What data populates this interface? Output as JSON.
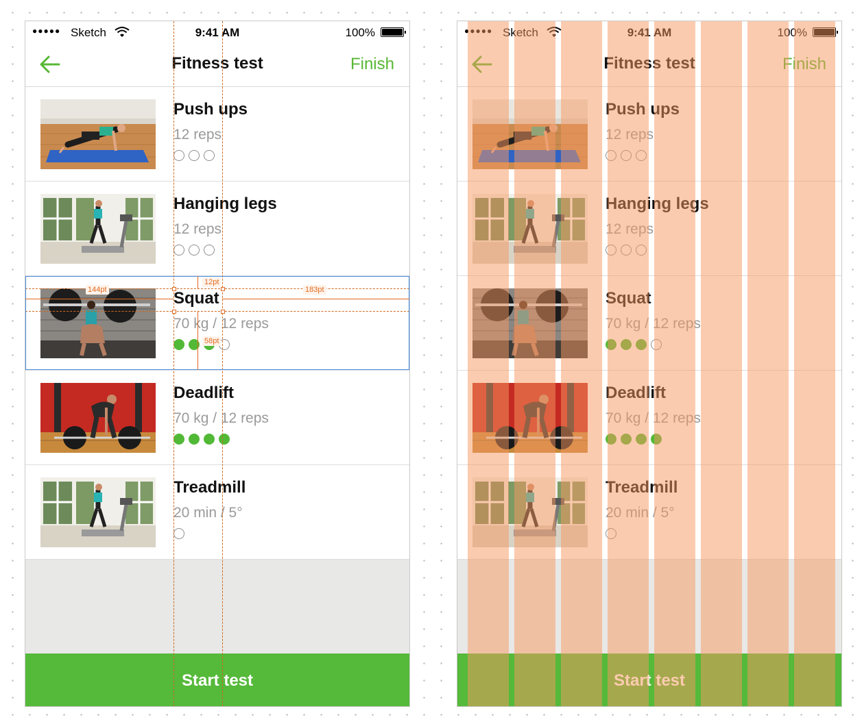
{
  "status_bar": {
    "signal": "●●●●●",
    "carrier": "Sketch",
    "time": "9:41 AM",
    "battery": "100%"
  },
  "nav": {
    "title": "Fitness test",
    "finish_label": "Finish",
    "back_icon": "arrow-left-icon",
    "accent_color": "#58b735"
  },
  "exercises": [
    {
      "name": "Push ups",
      "detail": "12 reps",
      "image": "push-up-photo",
      "completed": 0,
      "total": 3
    },
    {
      "name": "Hanging legs",
      "detail": "12 reps",
      "image": "treadmill-photo",
      "completed": 0,
      "total": 3
    },
    {
      "name": "Squat",
      "detail": "70 kg / 12 reps",
      "image": "barbell-squat-photo",
      "completed": 3,
      "total": 4
    },
    {
      "name": "Deadlift",
      "detail": "70 kg / 12 reps",
      "image": "deadlift-photo",
      "completed": 4,
      "total": 4
    },
    {
      "name": "Treadmill",
      "detail": "20 min / 5°",
      "image": "treadmill-photo",
      "completed": 0,
      "total": 1
    }
  ],
  "start_button": {
    "label": "Start test",
    "color": "#55b93a"
  },
  "measurements": {
    "left": "144pt",
    "top": "12pt",
    "right": "183pt",
    "bottom": "58pt"
  },
  "colors": {
    "guide": "#e06a20",
    "selection": "#4a8ee0",
    "grid_column": "#f89860"
  }
}
